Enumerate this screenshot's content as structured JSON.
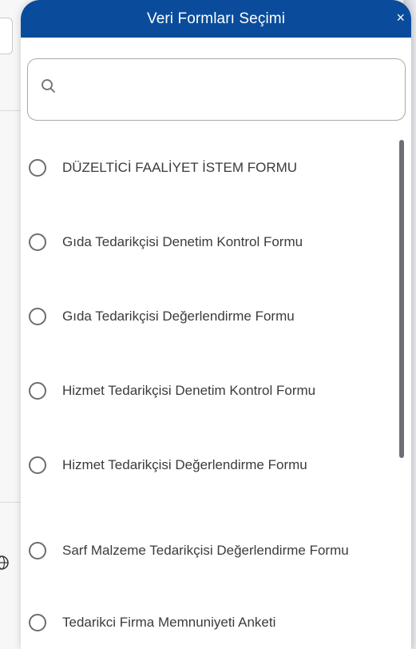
{
  "modal": {
    "title": "Veri Formları Seçimi",
    "close_label": "×",
    "header_color": "#0a4c9b"
  },
  "search": {
    "value": "",
    "placeholder": "",
    "icon": "search-icon"
  },
  "forms": [
    {
      "label": "DÜZELTİCİ FAALİYET İSTEM FORMU",
      "selected": false
    },
    {
      "label": "Gıda Tedarikçisi Denetim Kontrol Formu",
      "selected": false
    },
    {
      "label": "Gıda Tedarikçisi Değerlendirme Formu",
      "selected": false
    },
    {
      "label": "Hizmet Tedarikçisi Denetim Kontrol Formu",
      "selected": false
    },
    {
      "label": "Hizmet Tedarikçisi Değerlendirme Formu",
      "selected": false
    },
    {
      "label": "Sarf Malzeme Tedarikçisi Değerlendirme Formu",
      "selected": false
    },
    {
      "label": "Tedarikci Firma Memnuniyeti Anketi",
      "selected": false
    }
  ],
  "background": {
    "globe_icon": "globe-icon"
  }
}
